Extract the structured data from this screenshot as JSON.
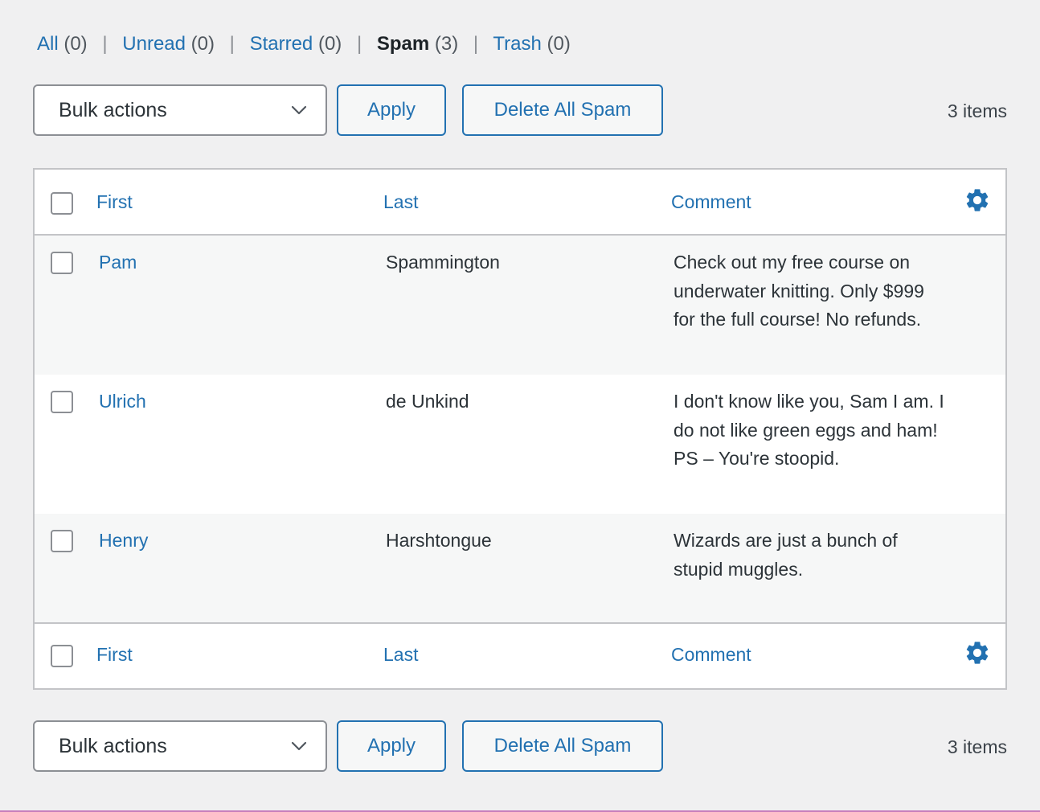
{
  "status_filter": [
    {
      "label": "All",
      "count": "(0)",
      "current": false
    },
    {
      "label": "Unread",
      "count": "(0)",
      "current": false
    },
    {
      "label": "Starred",
      "count": "(0)",
      "current": false
    },
    {
      "label": "Spam",
      "count": "(3)",
      "current": true
    },
    {
      "label": "Trash",
      "count": "(0)",
      "current": false
    }
  ],
  "tablenav": {
    "bulk_actions": "Bulk actions",
    "apply": "Apply",
    "delete_all_spam": "Delete All Spam",
    "items_count": "3 items"
  },
  "columns": {
    "first": "First",
    "last": "Last",
    "comment": "Comment"
  },
  "rows": [
    {
      "first": "Pam",
      "last": "Spammington",
      "comment": "Check out my free course on underwater knitting. Only $999 for the full course! No refunds."
    },
    {
      "first": "Ulrich",
      "last": "de Unkind",
      "comment": "I don't know like you, Sam I am. I do not like green eggs and ham! PS – You're stoopid."
    },
    {
      "first": "Henry",
      "last": "Harshtongue",
      "comment": "Wizards are just a bunch of stupid muggles."
    }
  ],
  "colors": {
    "link": "#2271b1",
    "border": "#c3c4c7",
    "alt_row": "#f6f7f7"
  }
}
